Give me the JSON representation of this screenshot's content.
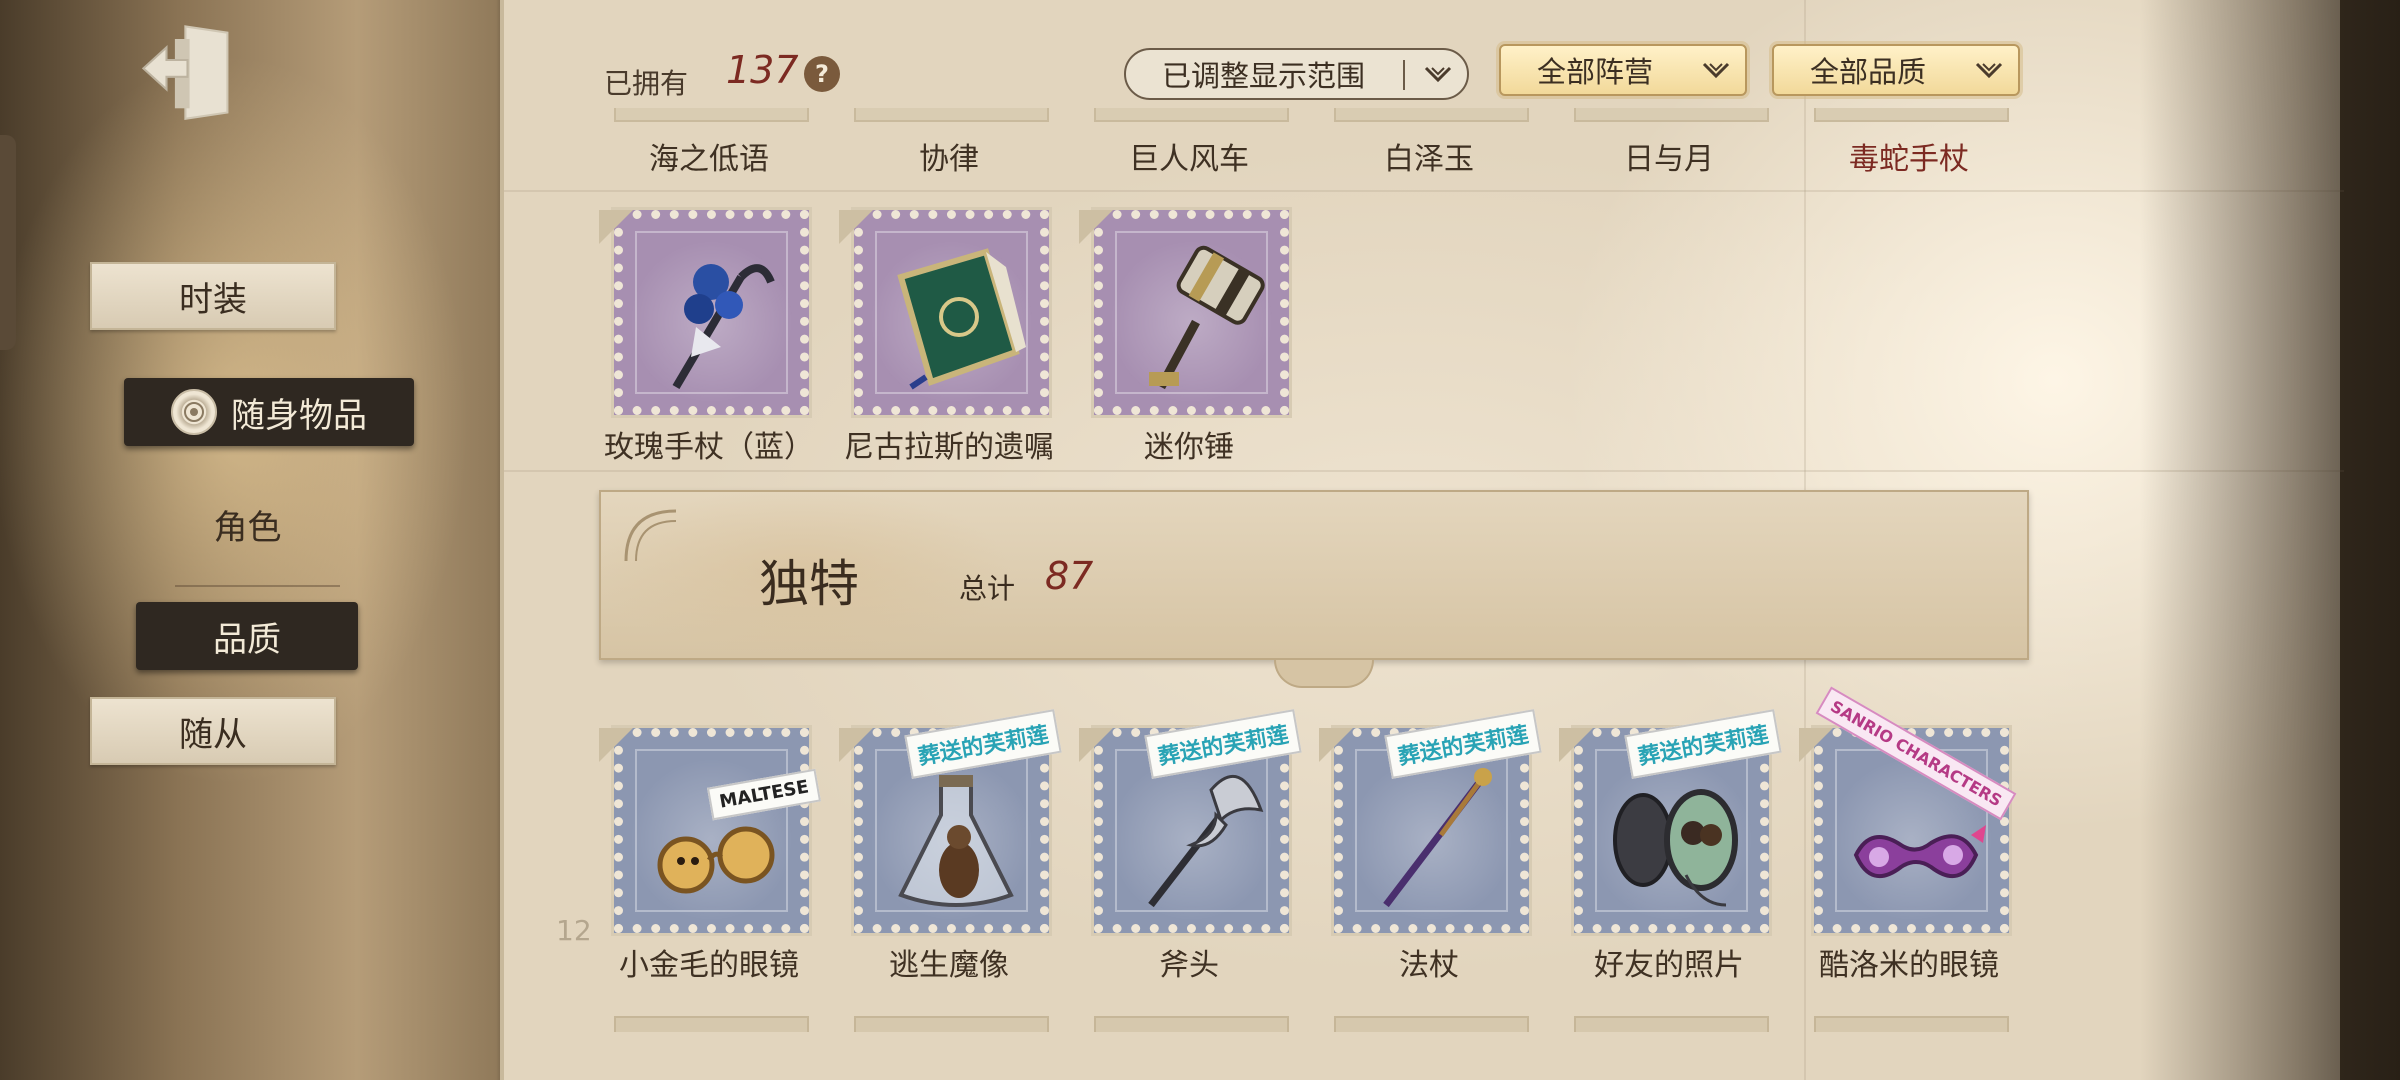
{
  "sidebar": {
    "tabs": [
      {
        "label": "时装"
      },
      {
        "label": "随身物品",
        "selected": true
      },
      {
        "label": "角色"
      },
      {
        "label": "品质"
      },
      {
        "label": "随从"
      }
    ]
  },
  "header": {
    "owned_label": "已拥有",
    "owned_count": "137",
    "help": "?",
    "range_filter": "已调整显示范围",
    "faction_filter": "全部阵营",
    "quality_filter": "全部品质"
  },
  "top_row_labels": [
    "海之低语",
    "协律",
    "巨人风车",
    "白泽玉",
    "日与月",
    "毒蛇手杖"
  ],
  "purple_items": [
    {
      "name": "玫瑰手杖（蓝）",
      "icon": "blue-rose-cane-icon"
    },
    {
      "name": "尼古拉斯的遗嘱",
      "icon": "green-book-icon"
    },
    {
      "name": "迷你锤",
      "icon": "mini-hammer-icon"
    }
  ],
  "section": {
    "title": "独特",
    "total_label": "总计",
    "total": "87"
  },
  "blue_items": [
    {
      "name": "小金毛的眼镜",
      "icon": "glasses-icon",
      "tag": "MALTESE"
    },
    {
      "name": "逃生魔像",
      "icon": "bottle-figure-icon",
      "tag": "葬送的芙莉莲"
    },
    {
      "name": "斧头",
      "icon": "axe-icon",
      "tag": "葬送的芙莉莲"
    },
    {
      "name": "法杖",
      "icon": "staff-icon",
      "tag": "葬送的芙莉莲"
    },
    {
      "name": "好友的照片",
      "icon": "locket-photo-icon",
      "tag": "葬送的芙莉莲"
    },
    {
      "name": "酷洛米的眼镜",
      "icon": "kuromi-glasses-icon",
      "tag": "SANRIO CHARACTERS"
    }
  ],
  "page_number": "12",
  "colors": {
    "accent_red": "#7c2a22",
    "stamp_purple": "#a78fb1",
    "stamp_blue": "#8c97b1",
    "dark_tab": "#2f2821"
  }
}
